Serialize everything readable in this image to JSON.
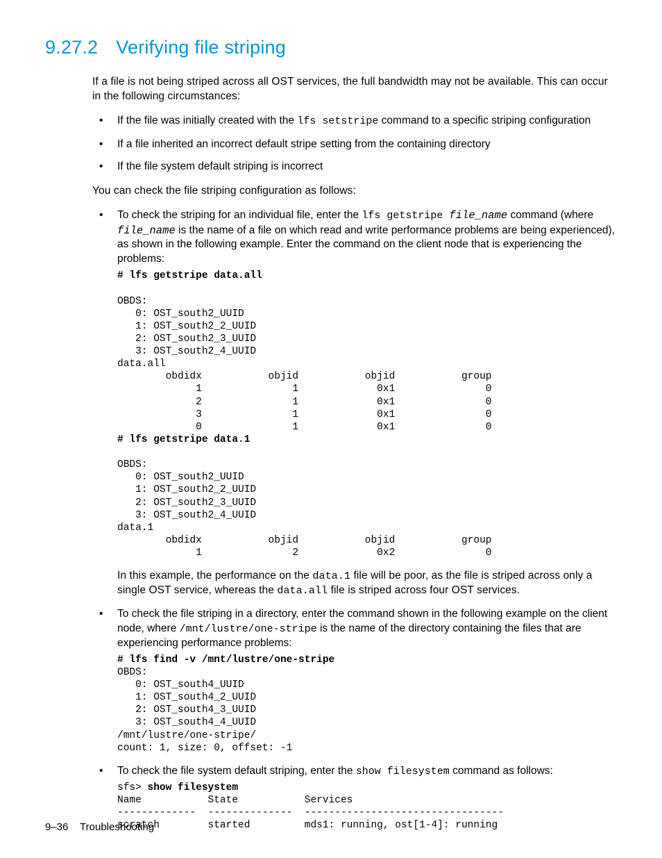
{
  "heading": {
    "number": "9.27.2",
    "title": "Verifying file striping"
  },
  "intro": "If a file is not being striped across all OST services, the full bandwidth may not be available. This can occur in the following circumstances:",
  "circ_bullets": {
    "b1_pre": "If the file was initially created with the ",
    "b1_code": "lfs setstripe",
    "b1_post": " command to a specific striping configuration",
    "b2": "If a file inherited an incorrect default stripe setting from the containing directory",
    "b3": "If the file system default striping is incorrect"
  },
  "check_intro": "You can check the file striping configuration as follows:",
  "item1": {
    "p1a": "To check the striping for an individual file, enter the ",
    "p1code1": "lfs getstripe ",
    "p1ital": "file_name",
    "p1b": " command (where ",
    "p1ital2": "file_name",
    "p1c": " is the name of a file on which read and write performance problems are being experienced), as shown in the following example. Enter the command on the client node that is experiencing the problems:"
  },
  "code1_cmd1": "# lfs getstripe data.all",
  "code1_body1": "OBDS:\n   0: OST_south2_UUID\n   1: OST_south2_2_UUID\n   2: OST_south2_3_UUID\n   3: OST_south2_4_UUID\ndata.all\n        obdidx           objid           objid           group\n             1               1             0x1               0\n             2               1             0x1               0\n             3               1             0x1               0\n             0               1             0x1               0",
  "code1_cmd2": "# lfs getstripe data.1",
  "code1_body2": "OBDS:\n   0: OST_south2_UUID\n   1: OST_south2_2_UUID\n   2: OST_south2_3_UUID\n   3: OST_south2_4_UUID\ndata.1\n        obdidx           objid           objid           group\n             1               2             0x2               0",
  "item1_after": {
    "a": "In this example, the performance on the ",
    "c1": "data.1",
    "b": " file will be poor, as the file is striped across only a single OST service, whereas the ",
    "c2": "data.all",
    "c": " file is striped across four OST services."
  },
  "item2": {
    "a": "To check the file striping in a directory, enter the command shown in the following example on the client node, where ",
    "c1": "/mnt/lustre/one-stripe",
    "b": " is the name of the directory containing the files that are experiencing performance problems:"
  },
  "code2_cmd": "# lfs find -v /mnt/lustre/one-stripe",
  "code2_body": "OBDS:\n   0: OST_south4_UUID\n   1: OST_south4_2_UUID\n   2: OST_south4_3_UUID\n   3: OST_south4_4_UUID\n/mnt/lustre/one-stripe/\ncount: 1, size: 0, offset: -1",
  "item3": {
    "a": "To check the file system default striping, enter the ",
    "c1": "show filesystem",
    "b": " command as follows:"
  },
  "code3_prompt": "sfs> ",
  "code3_cmd": "show filesystem",
  "code3_body": "Name           State           Services\n-------------  --------------  ---------------------------------\nscratch        started         mds1: running, ost[1-4]: running",
  "footer": {
    "page": "9–36",
    "label": "Troubleshooting"
  }
}
